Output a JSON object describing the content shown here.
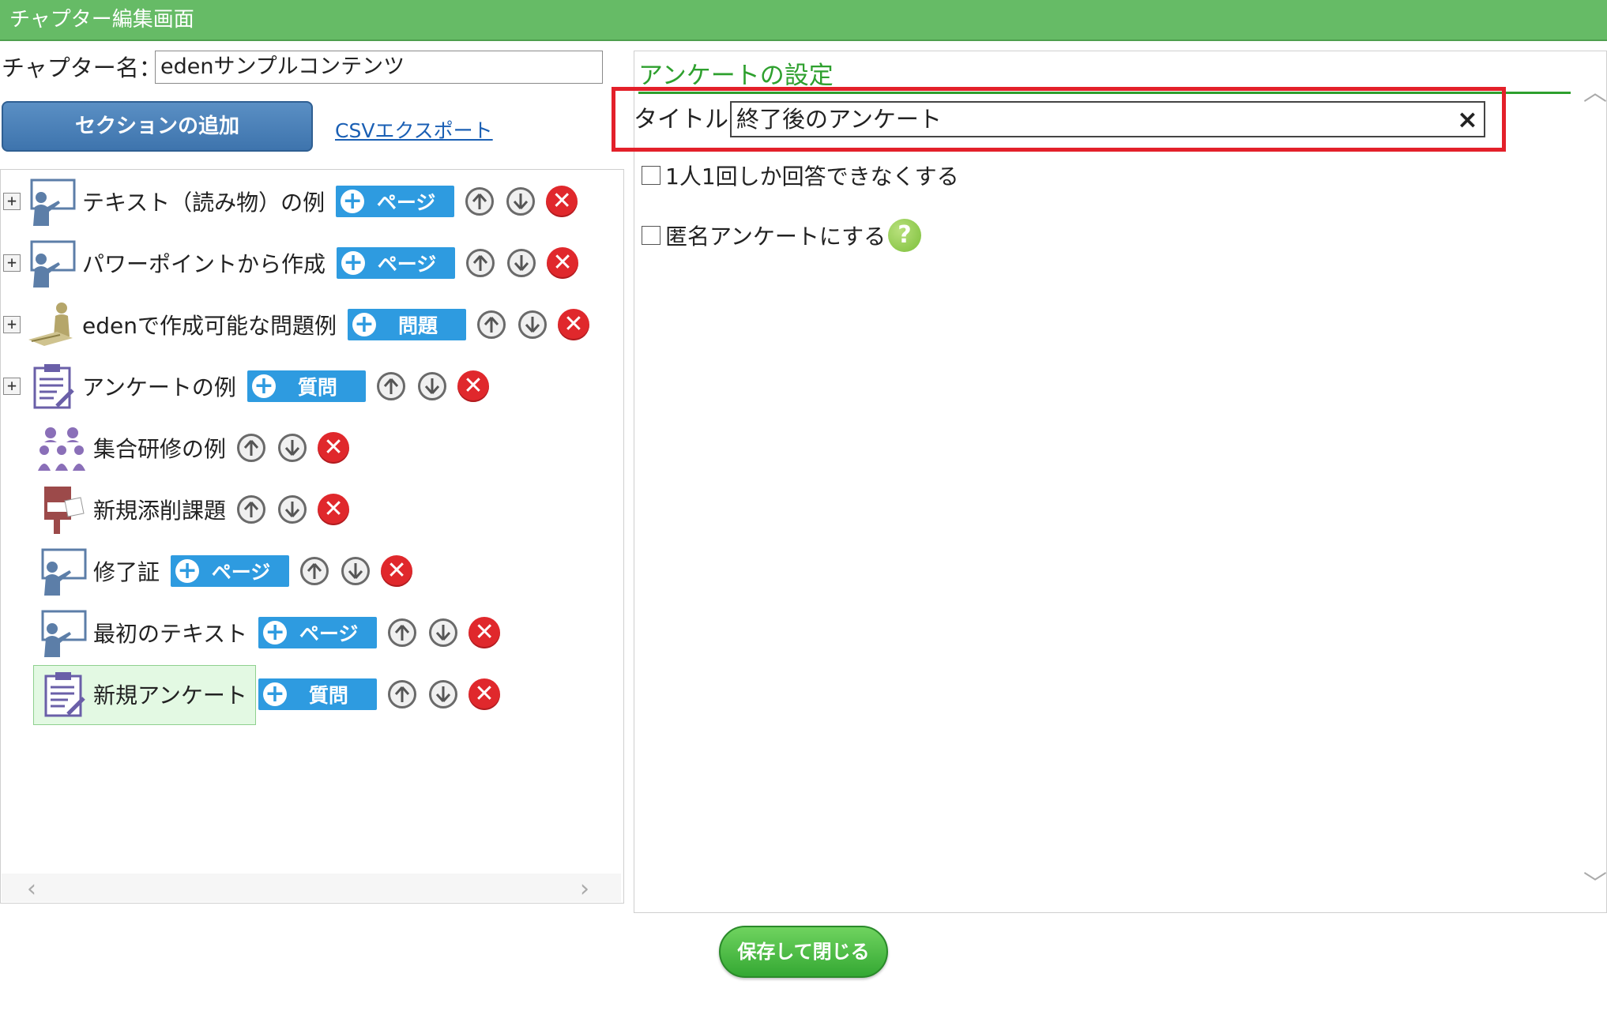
{
  "window": {
    "title": "チャプター編集画面"
  },
  "chapter": {
    "label": "チャプター名：",
    "name_value": "edenサンプルコンテンツ"
  },
  "toolbar": {
    "add_section_label": "セクションの追加",
    "csv_export_label": "CSVエクスポート"
  },
  "tree": {
    "items": [
      {
        "label": "テキスト（読み物）の例",
        "icon": "presentation-icon",
        "expandable": true,
        "add": "ページ"
      },
      {
        "label": "パワーポイントから作成",
        "icon": "presentation-icon",
        "expandable": true,
        "add": "ページ"
      },
      {
        "label": "edenで作成可能な問題例",
        "icon": "test-taker-icon",
        "expandable": true,
        "add": "問題"
      },
      {
        "label": "アンケートの例",
        "icon": "survey-icon",
        "expandable": true,
        "add": "質問"
      },
      {
        "label": "集合研修の例",
        "icon": "group-training-icon",
        "expandable": false,
        "add": ""
      },
      {
        "label": "新規添削課題",
        "icon": "post-box-icon",
        "expandable": false,
        "add": ""
      },
      {
        "label": "修了証",
        "icon": "presentation-icon",
        "expandable": false,
        "add": "ページ"
      },
      {
        "label": "最初のテキスト",
        "icon": "presentation-icon",
        "expandable": false,
        "add": "ページ"
      },
      {
        "label": "新規アンケート",
        "icon": "survey-icon",
        "expandable": false,
        "add": "質問",
        "selected": true
      }
    ]
  },
  "settings": {
    "heading": "アンケートの設定",
    "title_label": "タイトル:",
    "title_value": "終了後のアンケート",
    "clear_symbol": "×",
    "options": [
      {
        "label": "1人1回しか回答できなくする",
        "checked": false
      },
      {
        "label": "匿名アンケートにする",
        "checked": false
      }
    ],
    "help_symbol": "?"
  },
  "footer": {
    "save_close_label": "保存して閉じる"
  },
  "colors": {
    "header": "#66bb66",
    "accent_green": "#2ea02e",
    "add_button": "#2e9be0",
    "delete": "#e0282c",
    "highlight": "#e3202a"
  }
}
